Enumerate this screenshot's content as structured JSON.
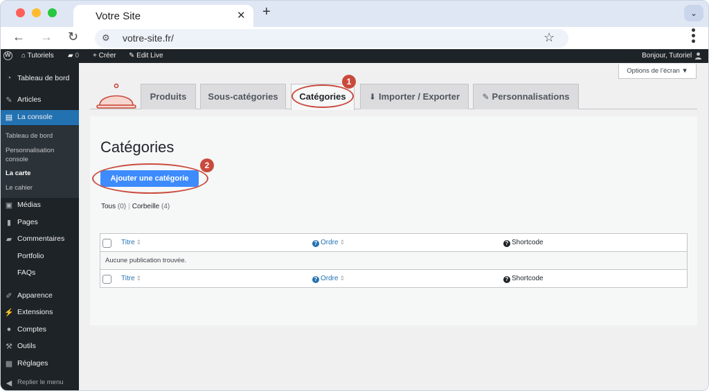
{
  "browser": {
    "tab_title": "Votre Site",
    "tab_close": "✕",
    "new_tab": "+",
    "url": "votre-site.fr/",
    "window_buttons": [
      "close",
      "minimize",
      "maximize"
    ]
  },
  "adminbar": {
    "site_name": "Tutoriels",
    "comments_count": "0",
    "create": "Créer",
    "edit_live": "Edit Live",
    "greeting": "Bonjour, Tutoriel"
  },
  "sidebar": {
    "items": [
      {
        "label": "Tableau de bord",
        "icon": "dashboard-icon"
      },
      {
        "label": "Articles",
        "icon": "pin-icon"
      },
      {
        "label": "La console",
        "icon": "console-icon"
      },
      {
        "label": "Médias",
        "icon": "media-icon"
      },
      {
        "label": "Pages",
        "icon": "pages-icon"
      },
      {
        "label": "Commentaires",
        "icon": "comments-icon"
      },
      {
        "label": "Portfolio",
        "icon": ""
      },
      {
        "label": "FAQs",
        "icon": ""
      },
      {
        "label": "Apparence",
        "icon": "appearance-icon"
      },
      {
        "label": "Extensions",
        "icon": "plugins-icon"
      },
      {
        "label": "Comptes",
        "icon": "users-icon"
      },
      {
        "label": "Outils",
        "icon": "tools-icon"
      },
      {
        "label": "Réglages",
        "icon": "settings-icon"
      }
    ],
    "submenu": [
      "Tableau de bord",
      "Personnalisation console",
      "La carte",
      "Le cahier"
    ],
    "collapse": "Replier le menu"
  },
  "main": {
    "screen_options": "Options de l’écran ▼",
    "tabs": [
      {
        "label": "Produits"
      },
      {
        "label": "Sous-catégories"
      },
      {
        "label": "Catégories"
      },
      {
        "label": "Importer / Exporter",
        "icon": "import-icon"
      },
      {
        "label": "Personnalisations",
        "icon": "brush-icon"
      }
    ],
    "badges": [
      "1",
      "2"
    ],
    "page_title": "Catégories",
    "add_button": "Ajouter une catégorie",
    "filters": {
      "all": "Tous",
      "all_count": "(0)",
      "separator": "|",
      "trash": "Corbeille",
      "trash_count": "(4)"
    },
    "table": {
      "col_title": "Titre",
      "col_order": "Ordre",
      "col_shortcode": "Shortcode",
      "empty": "Aucune publication trouvée."
    }
  },
  "colors": {
    "admin_dark": "#1d2327",
    "accent_blue": "#2271b1",
    "button_blue": "#3d8bfd",
    "annotation_red": "#c94a3c"
  }
}
